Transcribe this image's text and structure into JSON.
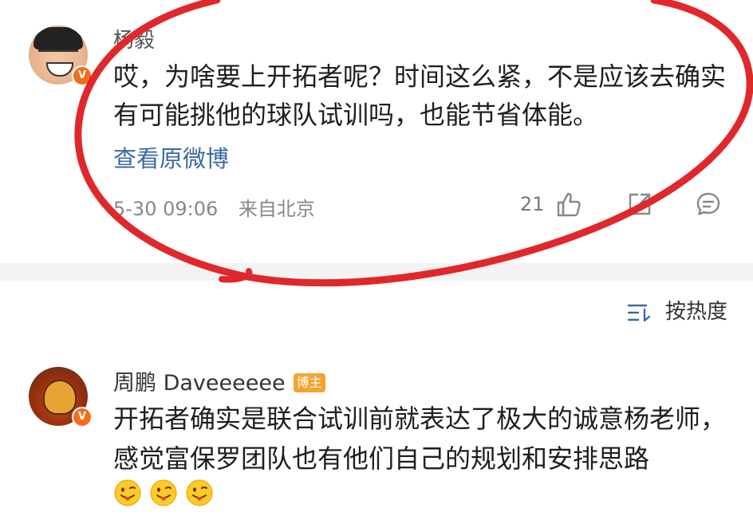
{
  "comments": [
    {
      "username": "杨毅",
      "content": "哎，为啥要上开拓者呢？时间这么紧，不是应该去确实有可能挑他的球队试训吗，也能节省体能。",
      "view_original": "查看原微博",
      "timestamp": "5-30 09:06",
      "location": "来自北京",
      "likes": "21",
      "verified": true,
      "verified_badge_label": "V"
    },
    {
      "username": "周鹏 Daveeeeee",
      "badge": "博主",
      "content": "开拓者确实是联合试训前就表达了极大的诚意杨老师，感觉富保罗团队也有他们自己的规划和安排思路",
      "verified": true,
      "verified_badge_label": "V",
      "emojis": [
        "tongue-emoji",
        "tongue-emoji",
        "tongue-emoji"
      ]
    }
  ],
  "sort": {
    "label": "按热度"
  },
  "colors": {
    "link": "#3a6a9e",
    "verified": "#f26d1d",
    "badge": "#f5a430",
    "annotation": "#e0282c"
  }
}
